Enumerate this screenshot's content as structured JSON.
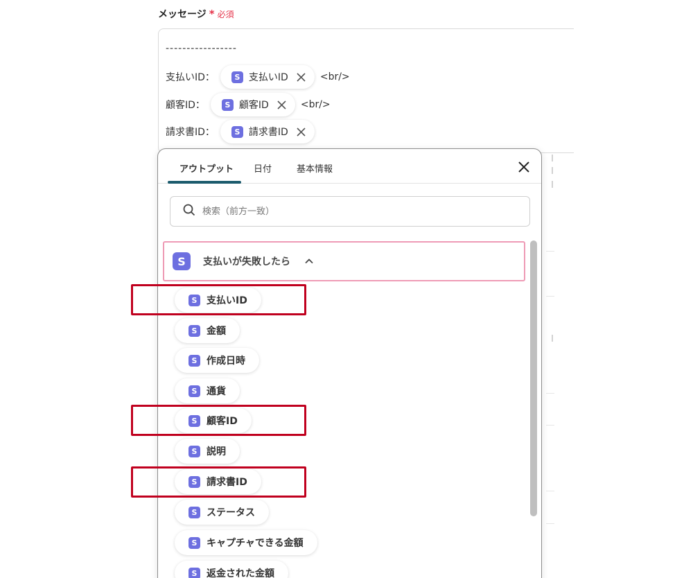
{
  "field": {
    "label": "メッセージ",
    "required_mark": "*",
    "required_text": "必須"
  },
  "editor": {
    "separator": "-----------------",
    "lines": [
      {
        "label": "支払いID：",
        "token": "支払いID",
        "suffix": "<br/>"
      },
      {
        "label": "顧客ID：",
        "token": "顧客ID",
        "suffix": "<br/>"
      },
      {
        "label": "請求書ID：",
        "token": "請求書ID",
        "suffix": ""
      }
    ]
  },
  "panel": {
    "tabs": [
      {
        "label": "アウトプット",
        "active": true
      },
      {
        "label": "日付",
        "active": false
      },
      {
        "label": "基本情報",
        "active": false
      }
    ],
    "search": {
      "placeholder": "検索（前方一致）",
      "value": ""
    },
    "group": {
      "title": "支払いが失敗したら",
      "icon": "S"
    },
    "items": [
      {
        "label": "支払いID",
        "highlighted": true
      },
      {
        "label": "金額",
        "highlighted": false
      },
      {
        "label": "作成日時",
        "highlighted": false
      },
      {
        "label": "通貨",
        "highlighted": false
      },
      {
        "label": "顧客ID",
        "highlighted": true
      },
      {
        "label": "説明",
        "highlighted": false
      },
      {
        "label": "請求書ID",
        "highlighted": true
      },
      {
        "label": "ステータス",
        "highlighted": false
      },
      {
        "label": "キャプチャできる金額",
        "highlighted": false
      },
      {
        "label": "返金された金額",
        "highlighted": false
      }
    ]
  },
  "icon_letter": "S",
  "colors": {
    "accent": "#1c5b6d",
    "stripe_icon": "#6d6fe0",
    "group_border": "#ee9ab5",
    "highlight": "#c0001e",
    "required": "#e5334a"
  }
}
